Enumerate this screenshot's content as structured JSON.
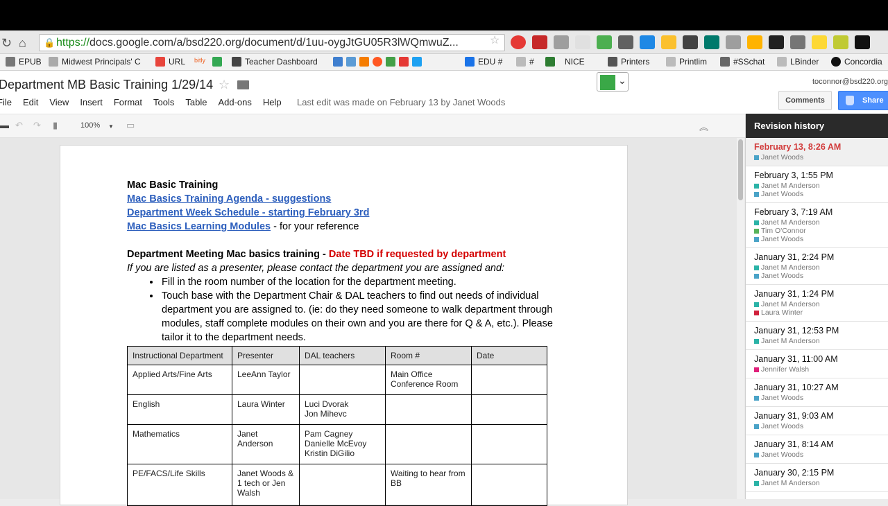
{
  "browser": {
    "url_https": "https://",
    "url_rest": "docs.google.com/a/bsd220.org/document/d/1uu-oygJtGU05R3lWQmwuZ...",
    "bookmarks": [
      {
        "label": "EPUB",
        "color": "#666666"
      },
      {
        "label": "Midwest Principals' C",
        "color": "#999999"
      },
      {
        "label": "URL",
        "color": "#e8453c"
      },
      {
        "label": "bitly",
        "color": "#ee6123"
      },
      {
        "label": "Teacher Dashboard",
        "color": "#333333"
      },
      {
        "label": "EDU #",
        "color": "#1a73e8"
      },
      {
        "label": "#",
        "color": "#777777"
      },
      {
        "label": "NICE",
        "color": "#333333"
      },
      {
        "label": "Printers",
        "color": "#555555"
      },
      {
        "label": "Printlim",
        "color": "#777777"
      },
      {
        "label": "#SSchat",
        "color": "#444444"
      },
      {
        "label": "LBinder",
        "color": "#777777"
      },
      {
        "label": "Concordia",
        "color": "#111111"
      }
    ]
  },
  "doc": {
    "title": "Department MB Basic Training 1/29/14",
    "menu": [
      "File",
      "Edit",
      "View",
      "Insert",
      "Format",
      "Tools",
      "Table",
      "Add-ons",
      "Help"
    ],
    "last_edit": "Last edit was made on February 13 by Janet Woods",
    "account": "toconnor@bsd220.org",
    "comments_label": "Comments",
    "share_label": "Share",
    "zoom": "100%"
  },
  "content": {
    "heading": "Mac Basic Training",
    "links": [
      {
        "text": "Mac Basics Training Agenda - suggestions",
        "suffix": ""
      },
      {
        "text": "Department Week Schedule - starting February 3rd",
        "suffix": ""
      },
      {
        "text": "Mac Basics Learning Modules",
        "suffix": " - for your reference"
      }
    ],
    "meeting_heading": "Department Meeting Mac basics training - ",
    "meeting_date": "Date TBD if requested by department",
    "instruction": "If you are listed as a presenter, please contact the department  you are assigned and:",
    "bullets": [
      "Fill in the room number of the location for the department meeting.",
      "Touch base with the Department Chair & DAL teachers to find out needs of individual department you are assigned to. (ie: do they need someone to walk department through modules, staff complete modules on their own and you are there for Q & A, etc.). Please tailor it to the department needs."
    ],
    "table": {
      "headers": [
        "Instructional Department",
        "Presenter",
        "DAL teachers",
        "Room #",
        "Date"
      ],
      "rows": [
        [
          "Applied Arts/Fine Arts",
          "LeeAnn Taylor",
          "",
          "Main Office Conference Room",
          ""
        ],
        [
          "English",
          "Laura Winter",
          "Luci Dvorak\nJon Mihevc",
          "",
          ""
        ],
        [
          "Mathematics",
          "Janet Anderson",
          "Pam Cagney\nDanielle McEvoy\nKristin DiGilio",
          "",
          ""
        ],
        [
          "PE/FACS/Life Skills",
          "Janet Woods & 1 tech or Jen Walsh",
          "",
          "Waiting to hear from BB",
          ""
        ]
      ]
    }
  },
  "revision_history": {
    "title": "Revision history",
    "entries": [
      {
        "date": "February 13, 8:26 AM",
        "selected": true,
        "authors": [
          {
            "name": "Janet Woods",
            "color": "#4aa3c7"
          }
        ]
      },
      {
        "date": "February 3, 1:55 PM",
        "authors": [
          {
            "name": "Janet M Anderson",
            "color": "#2bb3a7"
          },
          {
            "name": "Janet Woods",
            "color": "#4aa3c7"
          }
        ]
      },
      {
        "date": "February 3, 7:19 AM",
        "authors": [
          {
            "name": "Janet M Anderson",
            "color": "#2bb3a7"
          },
          {
            "name": "Tim O'Connor",
            "color": "#57b35a"
          },
          {
            "name": "Janet Woods",
            "color": "#4aa3c7"
          }
        ]
      },
      {
        "date": "January 31, 2:24 PM",
        "authors": [
          {
            "name": "Janet M Anderson",
            "color": "#2bb3a7"
          },
          {
            "name": "Janet Woods",
            "color": "#4aa3c7"
          }
        ]
      },
      {
        "date": "January 31, 1:24 PM",
        "authors": [
          {
            "name": "Janet M Anderson",
            "color": "#2bb3a7"
          },
          {
            "name": "Laura Winter",
            "color": "#d0203c"
          }
        ]
      },
      {
        "date": "January 31, 12:53 PM",
        "authors": [
          {
            "name": "Janet M Anderson",
            "color": "#2bb3a7"
          }
        ]
      },
      {
        "date": "January 31, 11:00 AM",
        "authors": [
          {
            "name": "Jennifer Walsh",
            "color": "#e0207a"
          }
        ]
      },
      {
        "date": "January 31, 10:27 AM",
        "authors": [
          {
            "name": "Janet Woods",
            "color": "#4aa3c7"
          }
        ]
      },
      {
        "date": "January 31, 9:03 AM",
        "authors": [
          {
            "name": "Janet Woods",
            "color": "#4aa3c7"
          }
        ]
      },
      {
        "date": "January 31, 8:14 AM",
        "authors": [
          {
            "name": "Janet Woods",
            "color": "#4aa3c7"
          }
        ]
      },
      {
        "date": "January 30, 2:15 PM",
        "authors": [
          {
            "name": "Janet M Anderson",
            "color": "#2bb3a7"
          }
        ]
      }
    ]
  }
}
